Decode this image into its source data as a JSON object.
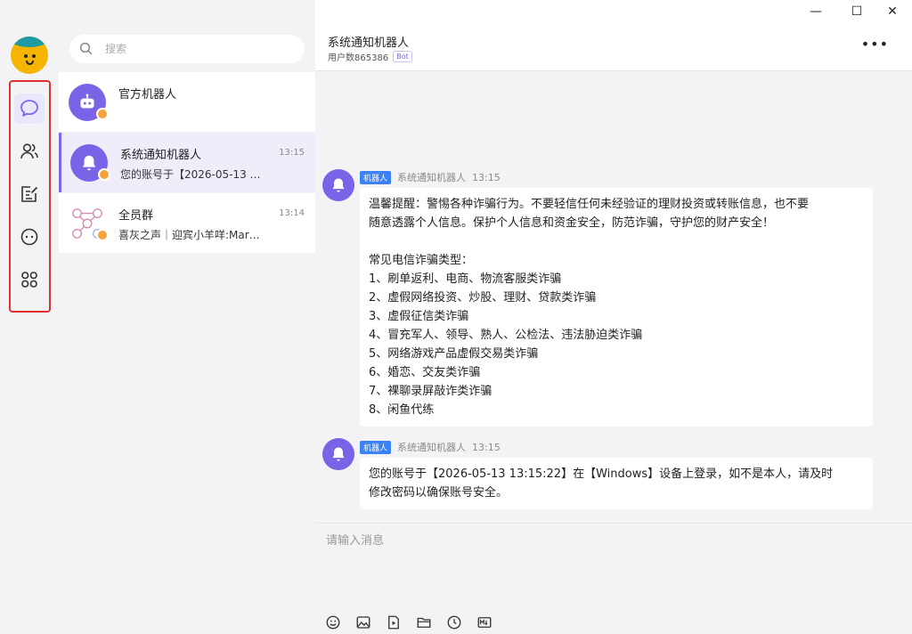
{
  "rail": {
    "items": [
      {
        "icon": "chat-bubble-icon",
        "active": true
      },
      {
        "icon": "contacts-icon",
        "active": false
      },
      {
        "icon": "notes-edit-icon",
        "active": false
      },
      {
        "icon": "robot-face-icon",
        "active": false
      },
      {
        "icon": "apps-grid-icon",
        "active": false
      }
    ],
    "accent": "#7b68ee",
    "highlight_border": "#e0302a"
  },
  "search": {
    "placeholder": "搜索"
  },
  "conversations": [
    {
      "name": "官方机器人",
      "time": "",
      "preview": "",
      "icon": "robot-icon"
    },
    {
      "name": "系统通知机器人",
      "time": "13:15",
      "preview": "您的账号于【2026-05-13 …",
      "icon": "bell-icon"
    },
    {
      "name": "全员群",
      "time": "13:14",
      "preview": "喜灰之声｜迎宾小羊咩:Mar…",
      "icon": "group-icon"
    }
  ],
  "chat": {
    "title": "系统通知机器人",
    "subtitle": "用户数865386",
    "bot_tag": "Bot",
    "more": "•••",
    "messages": [
      {
        "tag": "机器人",
        "sender": "系统通知机器人",
        "time": "13:15",
        "lines": [
          "温馨提醒：警惕各种诈骗行为。不要轻信任何未经验证的理财投资或转账信息，也不要",
          "随意透露个人信息。保护个人信息和资金安全，防范诈骗，守护您的财产安全！",
          "",
          "常见电信诈骗类型：",
          "1、刷单返利、电商、物流客服类诈骗",
          "2、虚假网络投资、炒股、理财、贷款类诈骗",
          "3、虚假征信类诈骗",
          "4、冒充军人、领导、熟人、公检法、违法胁迫类诈骗",
          "5、网络游戏产品虚假交易类诈骗",
          "6、婚恋、交友类诈骗",
          "7、裸聊录屏敲诈类诈骗",
          "8、闲鱼代练"
        ]
      },
      {
        "tag": "机器人",
        "sender": "系统通知机器人",
        "time": "13:15",
        "lines": [
          "您的账号于【2026-05-13 13:15:22】在【Windows】设备上登录，如不是本人，请及时",
          "修改密码以确保账号安全。"
        ]
      }
    ],
    "input_placeholder": "请输入消息",
    "toolbar": [
      "emoji-icon",
      "image-icon",
      "video-icon",
      "folder-icon",
      "clock-icon",
      "markdown-icon"
    ]
  },
  "window": {
    "minimize": "—",
    "maximize": "☐",
    "close": "✕"
  }
}
